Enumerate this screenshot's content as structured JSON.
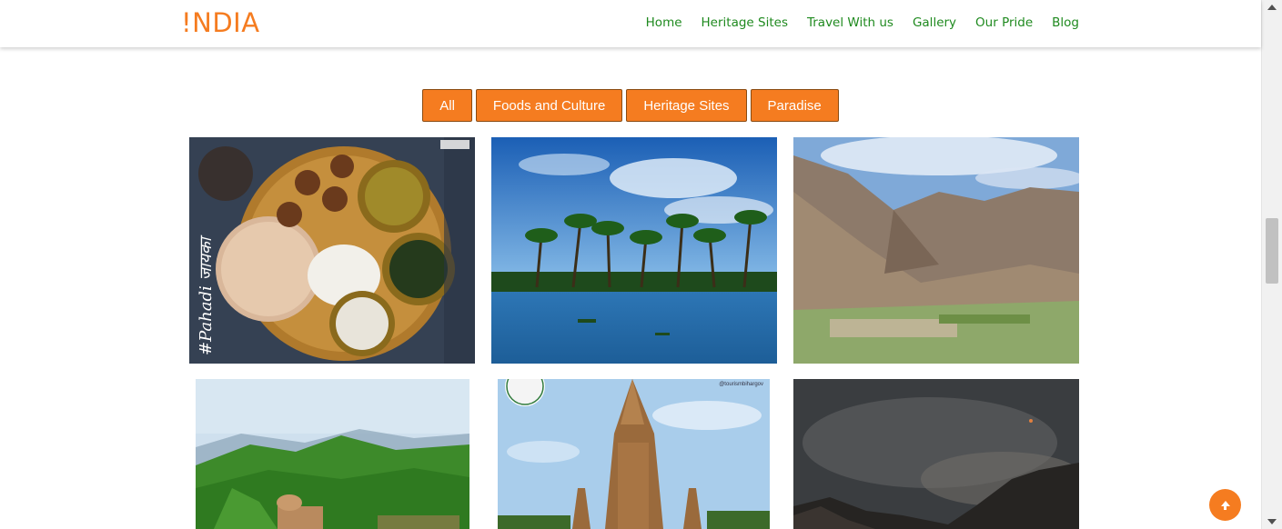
{
  "header": {
    "logo": "!NDIA",
    "nav": [
      "Home",
      "Heritage Sites",
      "Travel With us",
      "Gallery",
      "Our Pride",
      "Blog"
    ]
  },
  "filters": [
    "All",
    "Foods and Culture",
    "Heritage Sites",
    "Paradise"
  ],
  "gallery": {
    "tiles": [
      {
        "subject": "food-thali-image",
        "caption_overlay": "#Pahadi जायका"
      },
      {
        "subject": "palm-beach-image"
      },
      {
        "subject": "mountain-valley-image"
      },
      {
        "subject": "green-hills-fort-image"
      },
      {
        "subject": "temple-image",
        "watermark": "@tourismbihargov"
      },
      {
        "subject": "night-sky-mountain-image"
      }
    ]
  },
  "colors": {
    "accent": "#f57c20",
    "nav_text": "#1f8a1f"
  },
  "icons": {
    "back_to_top": "arrow-up-icon"
  }
}
